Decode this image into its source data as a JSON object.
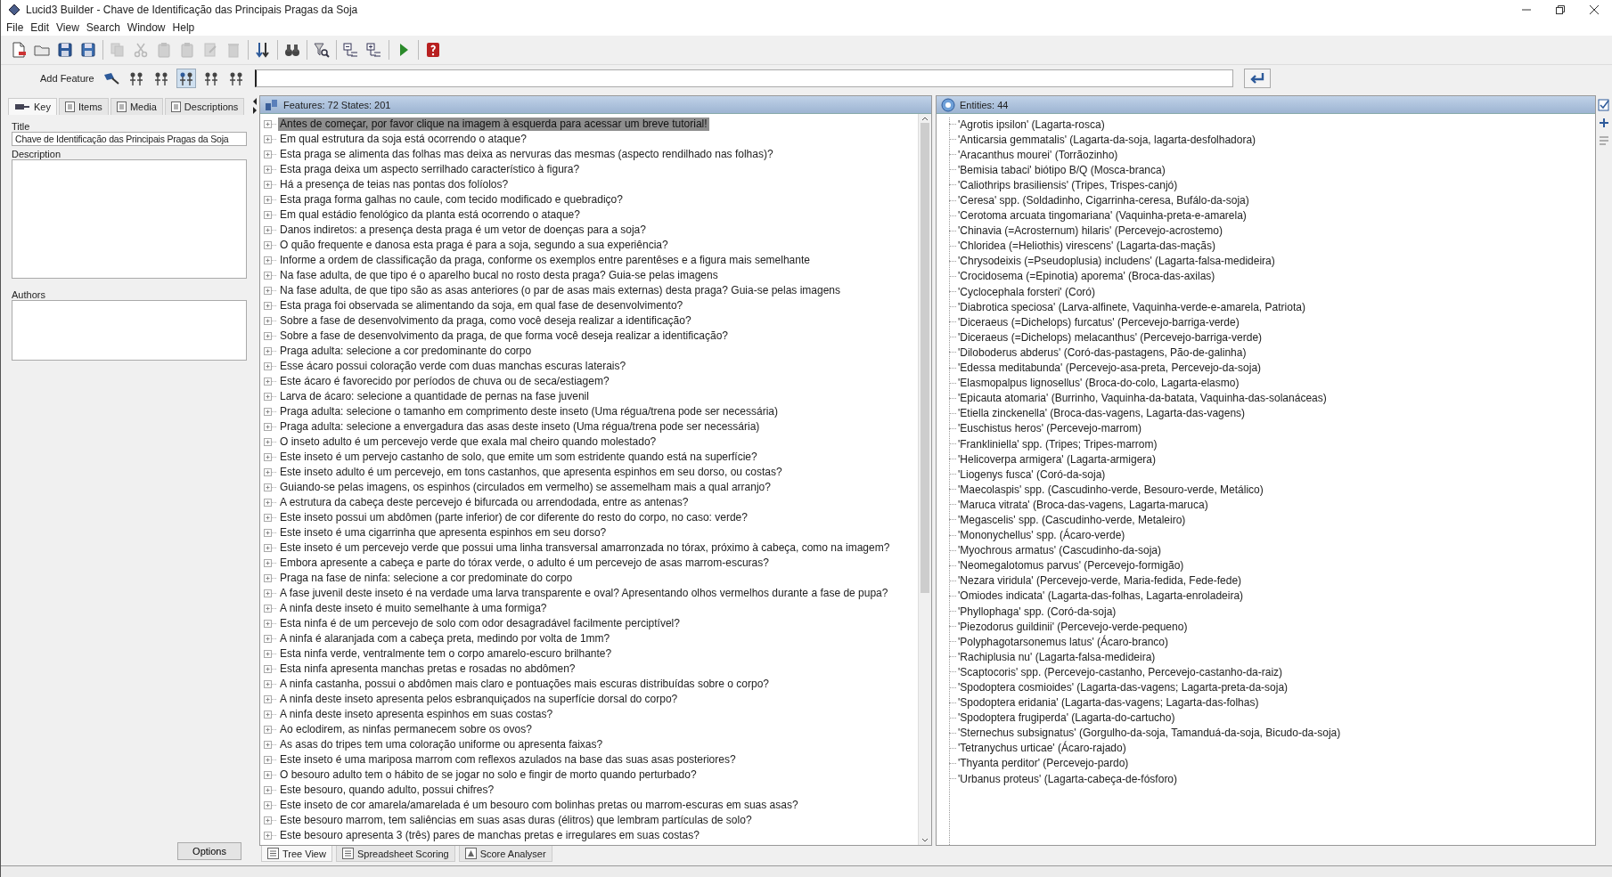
{
  "window": {
    "title": "Lucid3 Builder - Chave de Identificação das Principais Pragas da Soja"
  },
  "menu": [
    "File",
    "Edit",
    "View",
    "Search",
    "Window",
    "Help"
  ],
  "toolbar": [
    {
      "disabled": false
    },
    {
      "disabled": false
    },
    {
      "disabled": false
    },
    {
      "disabled": false
    },
    {
      "disabled": true
    },
    {
      "disabled": true
    },
    {
      "disabled": true
    },
    {
      "disabled": true
    },
    {
      "disabled": true
    },
    {
      "disabled": true
    },
    {
      "disabled": false
    },
    {
      "disabled": false
    },
    {
      "disabled": false
    },
    {
      "disabled": false
    },
    {
      "disabled": false
    },
    {
      "disabled": false
    },
    {
      "disabled": false
    }
  ],
  "add_feature": {
    "label": "Add Feature",
    "tools": [
      {
        "selected": false
      },
      {
        "selected": false
      },
      {
        "selected": true
      },
      {
        "selected": false
      },
      {
        "selected": false
      }
    ]
  },
  "key_panel": {
    "tabs": [
      {
        "label": "Key",
        "selected": true
      },
      {
        "label": "Items",
        "selected": false
      },
      {
        "label": "Media",
        "selected": false
      },
      {
        "label": "Descriptions",
        "selected": false
      }
    ],
    "title_label": "Title",
    "title_value": "Chave de Identificação das Principais Pragas da Soja",
    "description_label": "Description",
    "authors_label": "Authors",
    "options_button": "Options"
  },
  "features": {
    "header": "Features: 72 States: 201",
    "items": [
      {
        "text": "Antes de começar, por favor clique na imagem à esquerda para acessar um breve tutorial!",
        "selected": true
      },
      {
        "text": "Em qual estrutura da soja está ocorrendo o ataque?",
        "selected": false
      },
      {
        "text": "Esta praga se alimenta das folhas mas deixa as nervuras das mesmas (aspecto rendilhado nas folhas)?",
        "selected": false
      },
      {
        "text": "Esta praga deixa um aspecto serrilhado característico à figura?",
        "selected": false
      },
      {
        "text": "Há a presença de teias nas pontas dos folíolos?",
        "selected": false
      },
      {
        "text": "Esta praga forma galhas no caule, com tecido modificado e quebradiço?",
        "selected": false
      },
      {
        "text": "Em qual estádio fenológico da planta está ocorrendo o ataque?",
        "selected": false
      },
      {
        "text": "Danos indiretos: a presença desta praga é um vetor de doenças para a soja?",
        "selected": false
      },
      {
        "text": "O quão frequente e danosa esta praga é para a soja, segundo a sua experiência?",
        "selected": false
      },
      {
        "text": "Informe a ordem de classificação da praga, conforme os exemplos entre parentêses e a figura mais semelhante",
        "selected": false
      },
      {
        "text": "Na fase adulta, de que tipo é o aparelho bucal no rosto desta praga? Guia-se pelas imagens",
        "selected": false
      },
      {
        "text": "Na fase adulta, de que tipo são as asas anteriores (o par de asas mais externas) desta praga? Guia-se pelas imagens",
        "selected": false
      },
      {
        "text": "Esta praga foi observada se alimentando da soja, em qual fase de desenvolvimento?",
        "selected": false
      },
      {
        "text": "Sobre a fase de desenvolvimento da praga, como você deseja realizar a identificação?",
        "selected": false
      },
      {
        "text": "Sobre a fase de desenvolvimento da praga, de que forma você deseja realizar a identificação?",
        "selected": false
      },
      {
        "text": "Praga adulta: selecione a cor predominante do corpo",
        "selected": false
      },
      {
        "text": "Esse ácaro possui coloração verde com duas manchas escuras laterais?",
        "selected": false
      },
      {
        "text": "Este ácaro é favorecido por períodos de chuva ou de seca/estiagem?",
        "selected": false
      },
      {
        "text": "Larva de ácaro: selecione a quantidade de pernas na fase juvenil",
        "selected": false
      },
      {
        "text": "Praga adulta: selecione o tamanho em comprimento deste inseto (Uma régua/trena pode ser necessária)",
        "selected": false
      },
      {
        "text": "Praga adulta: selecione a envergadura das asas deste inseto (Uma régua/trena pode ser necessária)",
        "selected": false
      },
      {
        "text": "O inseto adulto é um percevejo verde que exala mal cheiro quando molestado?",
        "selected": false
      },
      {
        "text": "Este inseto é um pervejo castanho de solo, que emite um som estridente quando está na superfície?",
        "selected": false
      },
      {
        "text": "Este inseto adulto é um percevejo, em tons castanhos, que apresenta espinhos em seu dorso, ou costas?",
        "selected": false
      },
      {
        "text": "Guiando-se pelas imagens, os espinhos (circulados em vermelho) se assemelham mais a qual arranjo?",
        "selected": false
      },
      {
        "text": "A estrutura da cabeça deste percevejo é bifurcada ou arrendodada, entre as antenas?",
        "selected": false
      },
      {
        "text": "Este inseto possui um abdômen (parte inferior) de cor diferente do resto do corpo, no caso: verde?",
        "selected": false
      },
      {
        "text": "Este inseto é uma cigarrinha que apresenta espinhos em seu dorso?",
        "selected": false
      },
      {
        "text": "Este inseto é um percevejo verde que possui uma linha transversal amarronzada no tórax, próximo à cabeça, como na imagem?",
        "selected": false
      },
      {
        "text": "Embora apresente a cabeça e parte do tórax verde, o adulto é um percevejo de asas marrom-escuras?",
        "selected": false
      },
      {
        "text": "Praga na fase de ninfa: selecione a cor predominate do corpo",
        "selected": false
      },
      {
        "text": "A fase juvenil deste inseto é na verdade uma larva transparente e oval? Apresentando olhos vermelhos durante a fase de pupa?",
        "selected": false
      },
      {
        "text": "A ninfa deste inseto é muito semelhante à uma formiga?",
        "selected": false
      },
      {
        "text": "Esta ninfa é de um percevejo de solo com odor desagradável facilmente perciptível?",
        "selected": false
      },
      {
        "text": "A ninfa é alaranjada com a cabeça preta, medindo por volta de 1mm?",
        "selected": false
      },
      {
        "text": "Esta ninfa verde, ventralmente tem o corpo amarelo-escuro brilhante?",
        "selected": false
      },
      {
        "text": "Esta ninfa apresenta manchas pretas e rosadas no abdômen?",
        "selected": false
      },
      {
        "text": "A ninfa castanha, possui o abdômen mais claro e pontuações mais escuras distribuídas sobre o corpo?",
        "selected": false
      },
      {
        "text": "A ninfa deste inseto apresenta pelos esbranquiçados na superfície dorsal do corpo?",
        "selected": false
      },
      {
        "text": "A ninfa deste inseto apresenta espinhos em suas costas?",
        "selected": false
      },
      {
        "text": "Ao eclodirem, as ninfas permanecem sobre os ovos?",
        "selected": false
      },
      {
        "text": "As asas do tripes tem uma coloração uniforme ou apresenta faixas?",
        "selected": false
      },
      {
        "text": "Este inseto é uma mariposa marrom com reflexos azulados na base das suas asas posteriores?",
        "selected": false
      },
      {
        "text": "O besouro adulto tem o hábito de se jogar no solo e fingir de morto quando perturbado?",
        "selected": false
      },
      {
        "text": "Este besouro, quando adulto, possui chifres?",
        "selected": false
      },
      {
        "text": "Este inseto de cor amarela/amarelada é um besouro com bolinhas pretas ou marrom-escuras em suas asas?",
        "selected": false
      },
      {
        "text": "Este besouro marrom, tem saliências em suas asas duras (élitros) que lembram partículas de solo?",
        "selected": false
      },
      {
        "text": "Este besouro apresenta 3 (três) pares de manchas pretas e irregulares em suas costas?",
        "selected": false
      }
    ]
  },
  "entities": {
    "header": "Entities: 44",
    "items": [
      "'Agrotis ipsilon' (Lagarta-rosca)",
      "'Anticarsia gemmatalis' (Lagarta-da-soja, lagarta-desfolhadora)",
      "'Aracanthus mourei' (Torrãozinho)",
      "'Bemisia tabaci' biótipo B/Q (Mosca-branca)",
      "'Caliothrips brasiliensis' (Tripes, Trispes-canjó)",
      "'Ceresa' spp. (Soldadinho, Cigarrinha-ceresa, Bufálo-da-soja)",
      "'Cerotoma arcuata tingomariana' (Vaquinha-preta-e-amarela)",
      "'Chinavia (=Acrosternum) hilaris' (Percevejo-acrostemo)",
      "'Chloridea (=Heliothis) virescens' (Lagarta-das-maçãs)",
      "'Chrysodeixis (=Pseudoplusia) includens' (Lagarta-falsa-medideira)",
      "'Crocidosema (=Epinotia) aporema' (Broca-das-axilas)",
      "'Cyclocephala forsteri' (Coró)",
      "'Diabrotica speciosa' (Larva-alfinete, Vaquinha-verde-e-amarela, Patriota)",
      "'Diceraeus (=Dichelops) furcatus' (Percevejo-barriga-verde)",
      "'Diceraeus (=Dichelops) melacanthus' (Percevejo-barriga-verde)",
      "'Diloboderus abderus' (Coró-das-pastagens, Pão-de-galinha)",
      "'Edessa meditabunda' (Percevejo-asa-preta, Percevejo-da-soja)",
      "'Elasmopalpus lignosellus' (Broca-do-colo, Lagarta-elasmo)",
      "'Epicauta atomaria' (Burrinho, Vaquinha-da-batata, Vaquinha-das-solanáceas)",
      "'Etiella zinckenella' (Broca-das-vagens, Lagarta-das-vagens)",
      "'Euschistus heros' (Percevejo-marrom)",
      "'Frankliniella' spp. (Tripes; Tripes-marrom)",
      "'Helicoverpa armigera' (Lagarta-armigera)",
      "'Liogenys fusca' (Coró-da-soja)",
      "'Maecolaspis' spp. (Cascudinho-verde, Besouro-verde, Metálico)",
      "'Maruca vitrata' (Broca-das-vagens, Lagarta-maruca)",
      "'Megascelis' spp. (Cascudinho-verde, Metaleiro)",
      "'Mononychellus' spp. (Ácaro-verde)",
      "'Myochrous armatus' (Cascudinho-da-soja)",
      "'Neomegalotomus parvus' (Percevejo-formigão)",
      "'Nezara viridula' (Percevejo-verde, Maria-fedida, Fede-fede)",
      "'Omiodes indicata' (Lagarta-das-folhas, Lagarta-enroladeira)",
      "'Phyllophaga' spp. (Coró-da-soja)",
      "'Piezodorus guildinii' (Percevejo-verde-pequeno)",
      "'Polyphagotarsonemus latus' (Ácaro-branco)",
      "'Rachiplusia nu' (Lagarta-falsa-medideira)",
      "'Scaptocoris' spp. (Percevejo-castanho, Percevejo-castanho-da-raiz)",
      "'Spodoptera cosmioides' (Lagarta-das-vagens; Lagarta-preta-da-soja)",
      "'Spodoptera eridania' (Lagarta-das-vagens; Lagarta-das-folhas)",
      "'Spodoptera frugiperda' (Lagarta-do-cartucho)",
      "'Sternechus subsignatus' (Gorgulho-da-soja, Tamanduá-da-soja, Bicudo-da-soja)",
      "'Tetranychus urticae' (Ácaro-rajado)",
      "'Thyanta perditor' (Percevejo-pardo)",
      "'Urbanus proteus' (Lagarta-cabeça-de-fósforo)"
    ]
  },
  "view_tabs": [
    {
      "label": "Tree View",
      "selected": true
    },
    {
      "label": "Spreadsheet Scoring",
      "selected": false
    },
    {
      "label": "Score Analyser",
      "selected": false
    }
  ]
}
